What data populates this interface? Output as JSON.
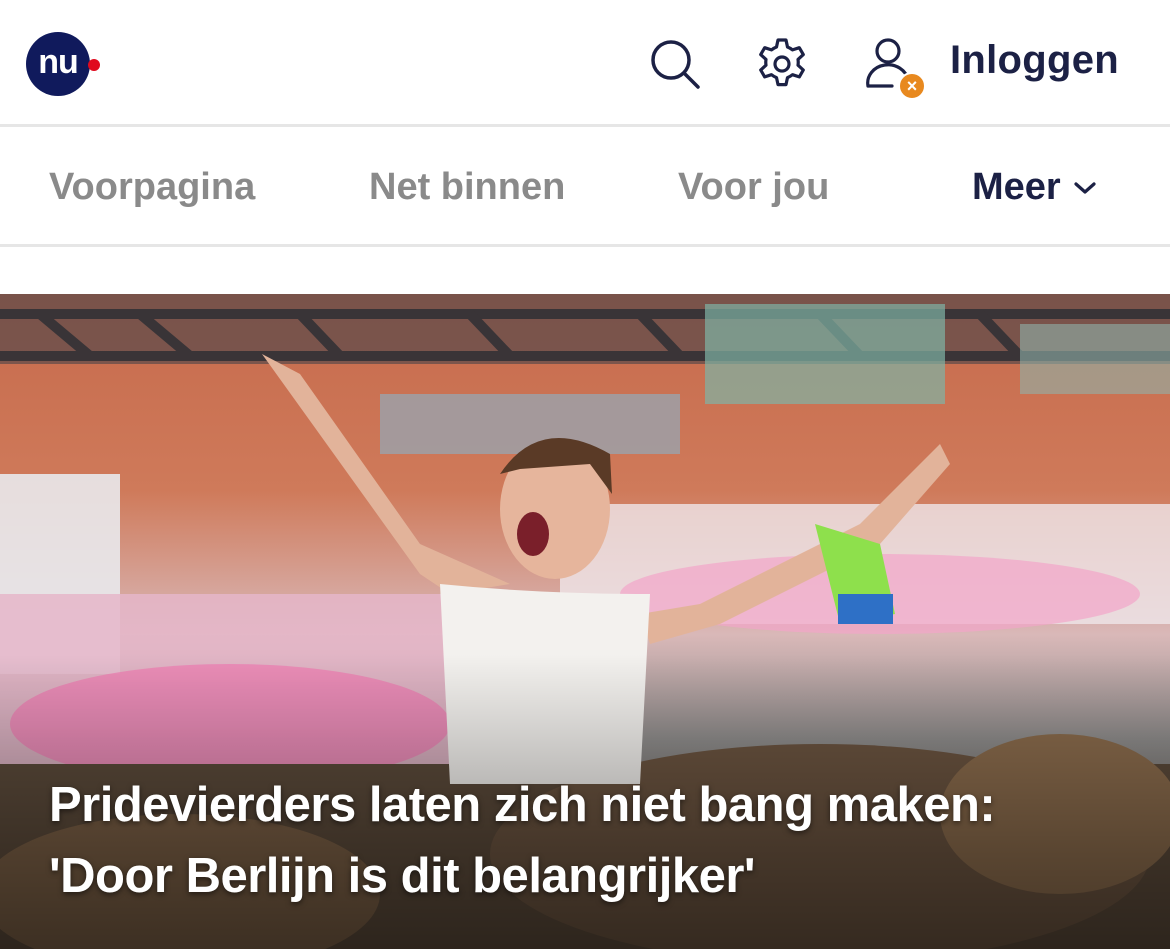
{
  "header": {
    "logo_text": "nu",
    "login_label": "Inloggen",
    "icons": [
      "search-icon",
      "gear-icon",
      "user-icon",
      "close-badge-icon"
    ],
    "badge_symbol": "×",
    "colors": {
      "logo": "#101a5c",
      "logo_dot": "#e00a1e",
      "badge": "#e8891f",
      "text": "#1c2145"
    }
  },
  "nav": {
    "items": [
      "Voorpagina",
      "Net binnen",
      "Voor jou"
    ],
    "more_label": "Meer"
  },
  "hero": {
    "headline": "Pridevierders laten zich niet bang maken: 'Door Berlijn is dit belangrijker'"
  }
}
